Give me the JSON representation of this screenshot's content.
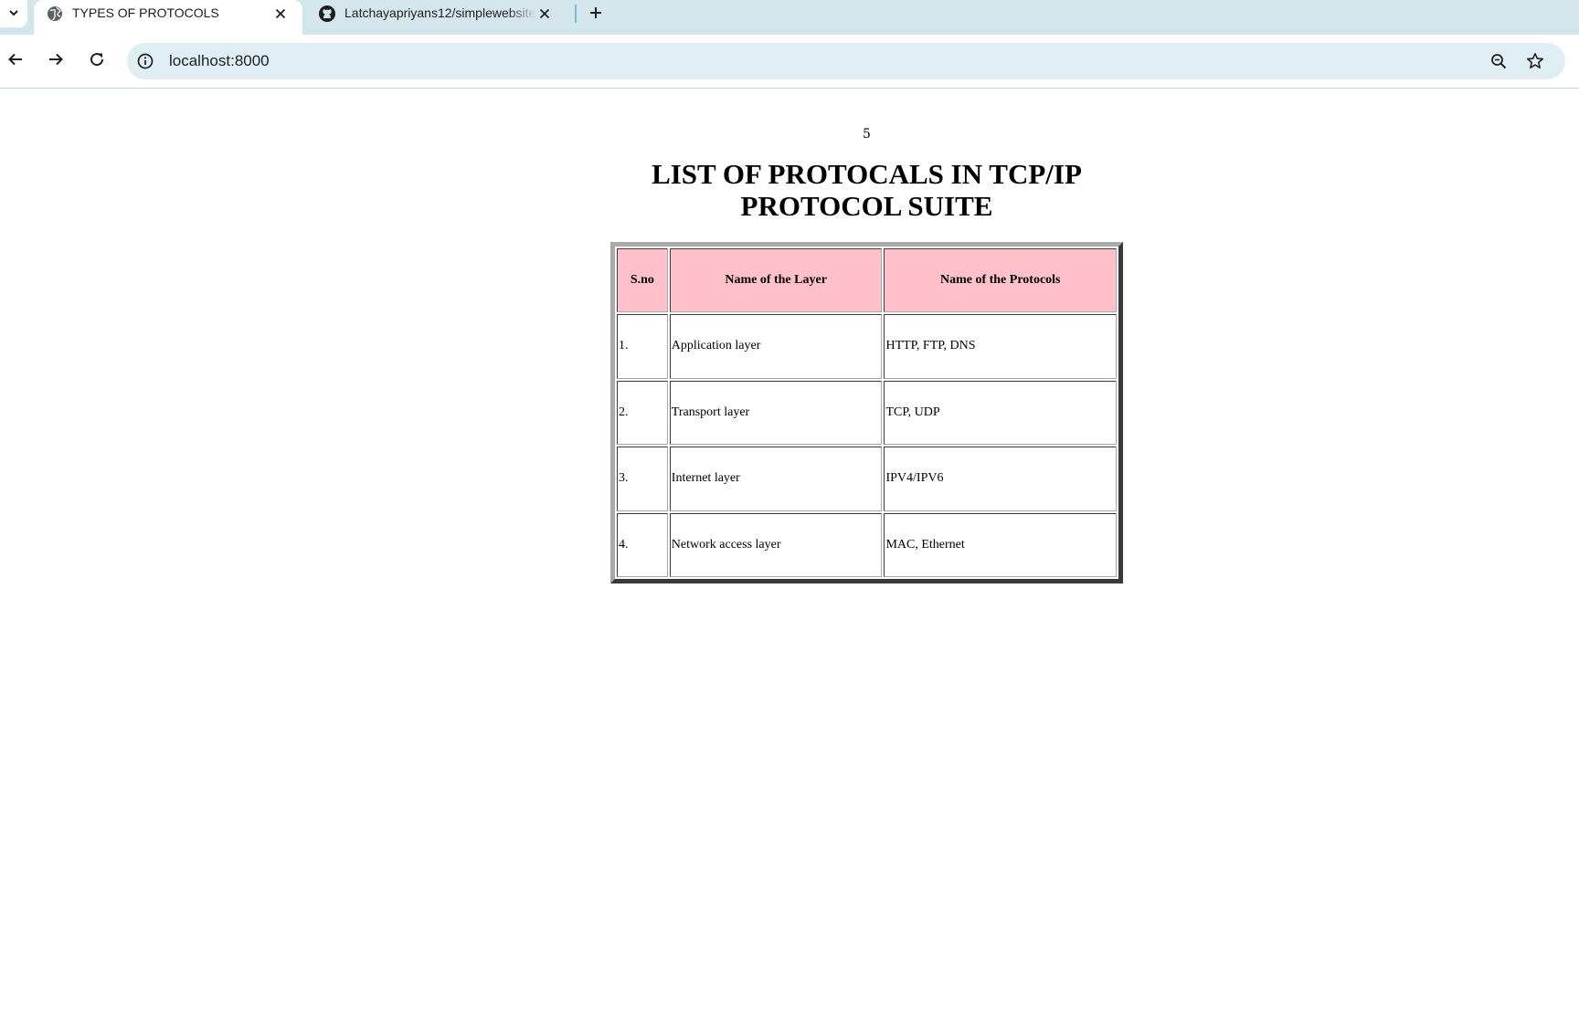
{
  "browser": {
    "tabs": [
      {
        "title": "TYPES OF PROTOCOLS",
        "active": true,
        "icon": "globe-icon"
      },
      {
        "title": "Latchayapriyans12/simplewebsite",
        "active": false,
        "icon": "github-icon"
      }
    ],
    "address_bar": {
      "url": "localhost:8000"
    }
  },
  "page": {
    "number": "5",
    "heading_line1": "LIST OF PROTOCALS IN TCP/IP",
    "heading_line2": "PROTOCOL SUITE",
    "table": {
      "header_color": "#ffc0cb",
      "headers": [
        "S.no",
        "Name of the Layer",
        "Name of the Protocols"
      ],
      "rows": [
        [
          "1.",
          "Application layer",
          "HTTP, FTP, DNS"
        ],
        [
          "2.",
          "Transport layer",
          "TCP, UDP"
        ],
        [
          "3.",
          "Internet layer",
          "IPV4/IPV6"
        ],
        [
          "4.",
          "Network access layer",
          "MAC, Ethernet"
        ]
      ]
    }
  }
}
